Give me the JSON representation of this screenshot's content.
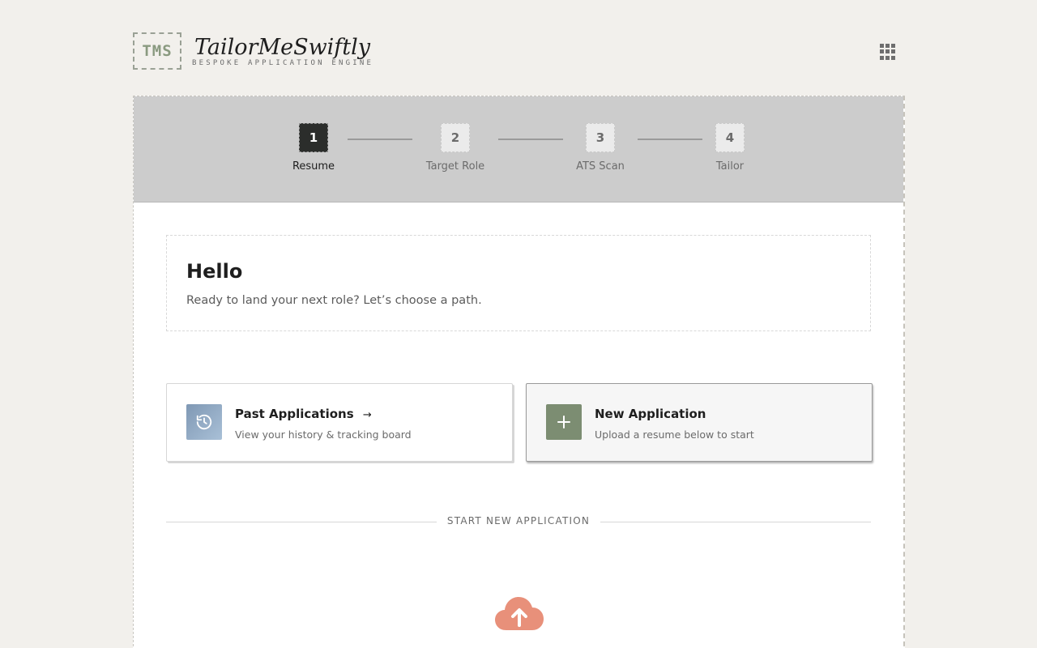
{
  "header": {
    "logo_badge": "TMS",
    "app_name": "TailorMeSwiftly",
    "tagline": "BESPOKE APPLICATION ENGINE",
    "menu_icon": "apps-grid-icon"
  },
  "stepper": {
    "steps": [
      {
        "number": "1",
        "label": "Resume",
        "active": true
      },
      {
        "number": "2",
        "label": "Target Role",
        "active": false
      },
      {
        "number": "3",
        "label": "ATS Scan",
        "active": false
      },
      {
        "number": "4",
        "label": "Tailor",
        "active": false
      }
    ]
  },
  "greeting": {
    "title": "Hello",
    "subtitle": "Ready to land your next role? Let’s choose a path."
  },
  "actions": {
    "past": {
      "title": "Past Applications",
      "arrow": "→",
      "subtitle": "View your history & tracking board",
      "icon": "history-icon"
    },
    "new": {
      "title": "New Application",
      "subtitle": "Upload a resume below to start",
      "icon": "plus-icon"
    }
  },
  "divider": {
    "label": "START NEW APPLICATION"
  },
  "upload": {
    "icon": "cloud-upload-icon"
  },
  "colors": {
    "background": "#f2f0ec",
    "stepper_bg": "#cccccc",
    "accent_green": "#7c8d72",
    "upload_coral": "#e8907a",
    "history_blue": "#8fa8c4"
  }
}
